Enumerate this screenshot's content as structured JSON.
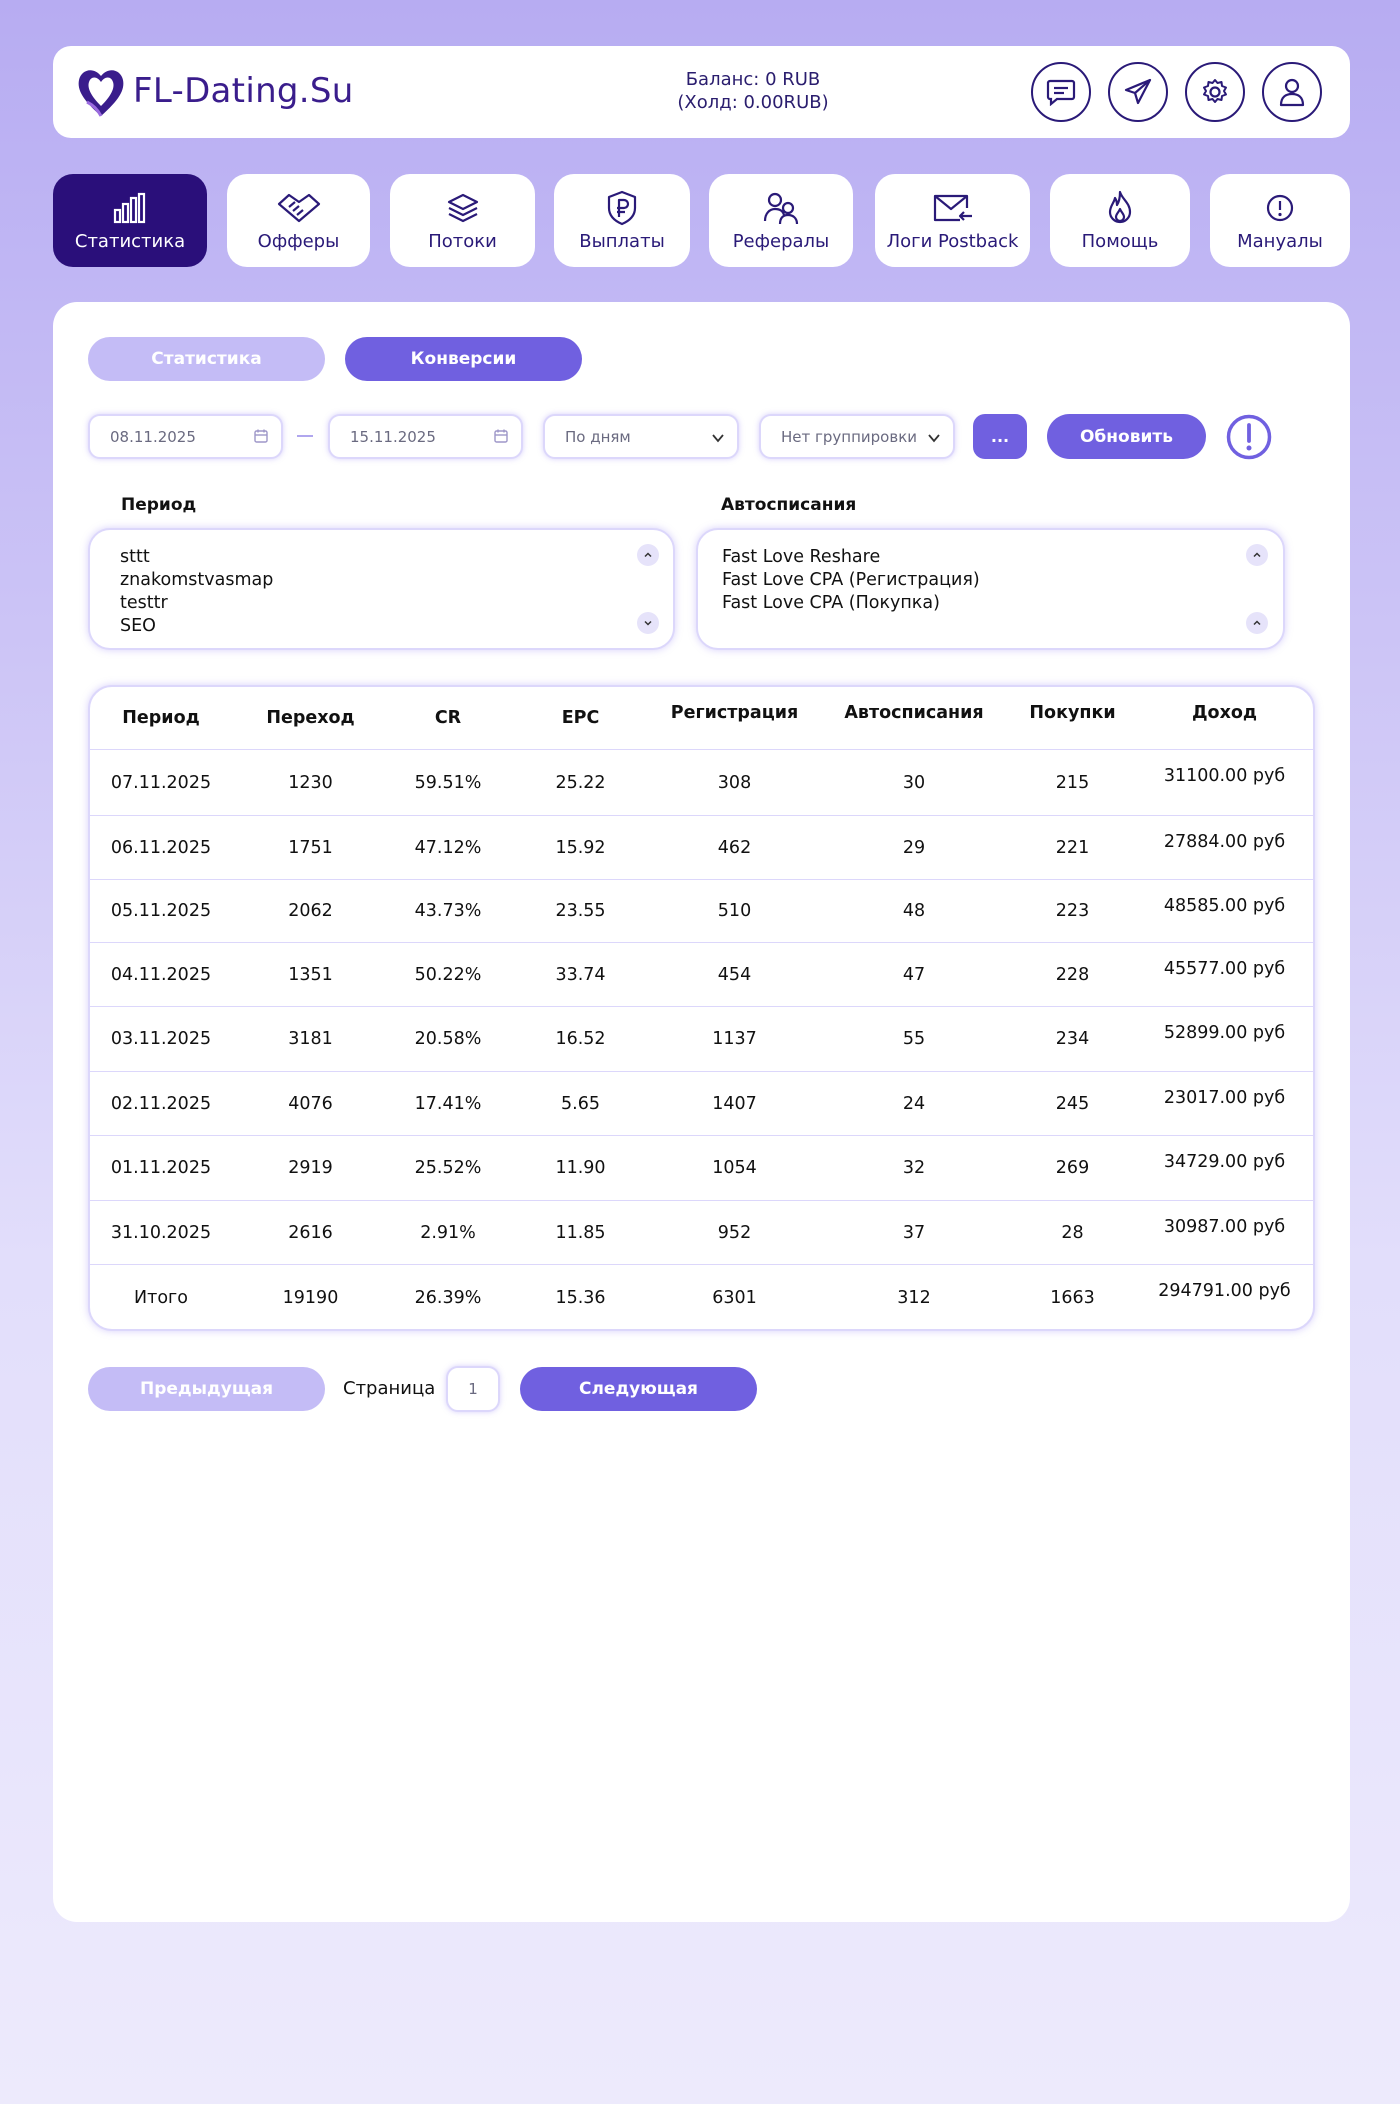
{
  "header": {
    "logo_text": "FL-Dating.Su",
    "balance": "Баланс: 0 RUB",
    "hold": "(Холд: 0.00RUB)",
    "icons": [
      "chat-icon",
      "telegram-icon",
      "settings-icon",
      "profile-icon"
    ]
  },
  "nav": [
    {
      "label": "Статистика",
      "icon": "chart-icon",
      "active": true
    },
    {
      "label": "Офферы",
      "icon": "handshake-icon"
    },
    {
      "label": "Потоки",
      "icon": "layers-icon"
    },
    {
      "label": "Выплаты",
      "icon": "ruble-shield-icon"
    },
    {
      "label": "Рефералы",
      "icon": "users-icon"
    },
    {
      "label": "Логи Postback",
      "icon": "mail-icon"
    },
    {
      "label": "Помощь",
      "icon": "fire-icon"
    },
    {
      "label": "Мануалы",
      "icon": "info-icon"
    }
  ],
  "tabs": {
    "stats": "Статистика",
    "conversions": "Конверсии"
  },
  "filters": {
    "date_from": "08.11.2025",
    "date_to": "15.11.2025",
    "interval": "По дням",
    "grouping": "Нет группировки",
    "more": "...",
    "refresh": "Обновить"
  },
  "period_select": {
    "label": "Период",
    "items": [
      "sttt",
      "znakomstvasmap",
      "testtr",
      "SEO"
    ]
  },
  "auto_select": {
    "label": "Автосписания",
    "items": [
      "Fast Love Reshare",
      "Fast Love CPA (Регистрация)",
      "Fast Love CPA (Покупка)"
    ]
  },
  "table": {
    "headers": [
      "Период",
      "Переход",
      "CR",
      "EPC",
      "Регистрация",
      "Автосписания",
      "Покупки",
      "Доход"
    ],
    "rows": [
      [
        "07.11.2025",
        "1230",
        "59.51%",
        "25.22",
        "308",
        "30",
        "215",
        "31100.00 руб"
      ],
      [
        "06.11.2025",
        "1751",
        "47.12%",
        "15.92",
        "462",
        "29",
        "221",
        "27884.00 руб"
      ],
      [
        "05.11.2025",
        "2062",
        "43.73%",
        "23.55",
        "510",
        "48",
        "223",
        "48585.00 руб"
      ],
      [
        "04.11.2025",
        "1351",
        "50.22%",
        "33.74",
        "454",
        "47",
        "228",
        "45577.00 руб"
      ],
      [
        "03.11.2025",
        "3181",
        "20.58%",
        "16.52",
        "1137",
        "55",
        "234",
        "52899.00 руб"
      ],
      [
        "02.11.2025",
        "4076",
        "17.41%",
        "5.65",
        "1407",
        "24",
        "245",
        "23017.00 руб"
      ],
      [
        "01.11.2025",
        "2919",
        "25.52%",
        "11.90",
        "1054",
        "32",
        "269",
        "34729.00 руб"
      ],
      [
        "31.10.2025",
        "2616",
        "2.91%",
        "11.85",
        "952",
        "37",
        "28",
        "30987.00 руб"
      ],
      [
        "Итого",
        "19190",
        "26.39%",
        "15.36",
        "6301",
        "312",
        "1663",
        "294791.00 руб"
      ]
    ]
  },
  "pagination": {
    "prev": "Предыдущая",
    "page_label": "Страница",
    "page": "1",
    "next": "Следующая"
  },
  "colors": {
    "accent": "#7060e0",
    "accent_light": "#c4bcf6",
    "nav_active": "#2a0f7a",
    "text_dark": "#2a1a78"
  }
}
